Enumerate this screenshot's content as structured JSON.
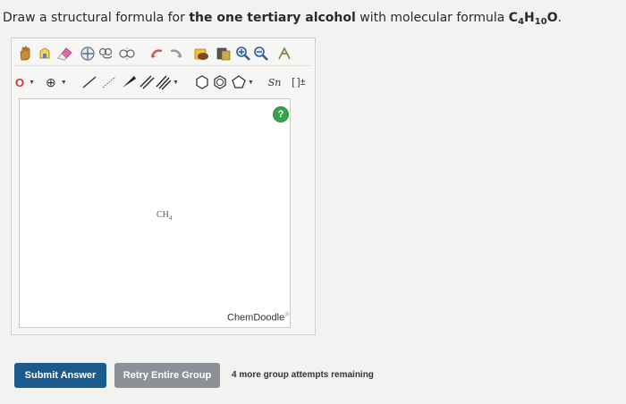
{
  "question": {
    "prefix": "Draw a structural formula for ",
    "emphasis": "the one tertiary alcohol",
    "middle": " with molecular formula ",
    "formula": {
      "c": "C",
      "c_sub": "4",
      "h": "H",
      "h_sub": "10",
      "o": "O"
    },
    "suffix": "."
  },
  "toolbar": {
    "row1": [
      "hand-icon",
      "lasso-icon",
      "eraser-icon",
      "center-icon",
      "rotate-icon",
      "flip-icon",
      "undo-icon",
      "redo-icon",
      "paste-icon",
      "copy-icon",
      "zoom-in-icon",
      "zoom-out-icon",
      "clean-icon"
    ],
    "row2": {
      "atom_label": "O",
      "charge_label": "⊕",
      "sgroup_label": "Sn",
      "brackets_label": "[ ]±"
    }
  },
  "canvas": {
    "help_label": "?",
    "molecule": {
      "text": "CH",
      "sub": "4"
    },
    "brand": "ChemDoodle",
    "brand_mark": "®"
  },
  "actions": {
    "submit_label": "Submit Answer",
    "retry_label": "Retry Entire Group",
    "attempts_text": "4 more group attempts remaining"
  },
  "colors": {
    "submit_bg": "#1c5a8c",
    "retry_bg": "#8b9196",
    "help_bg": "#35a64b"
  }
}
